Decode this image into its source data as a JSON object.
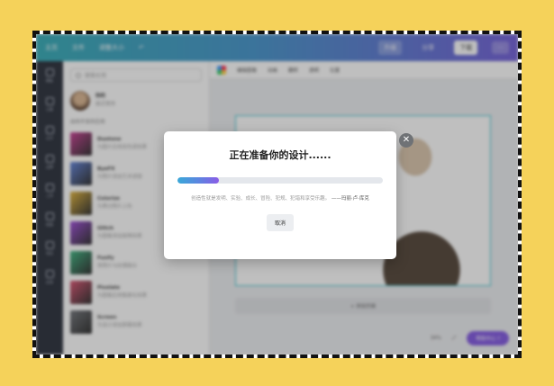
{
  "topbar": {
    "home": "主页",
    "file": "文件",
    "resize": "调整大小",
    "undo_icon": "undo-icon",
    "share": "分享",
    "download": "下载",
    "more": "···",
    "plan": "升级"
  },
  "sidebar_rail": [
    {
      "label": "模板",
      "icon": "template-icon"
    },
    {
      "label": "元素",
      "icon": "elements-icon"
    },
    {
      "label": "文字",
      "icon": "text-icon"
    },
    {
      "label": "品牌",
      "icon": "brand-icon"
    },
    {
      "label": "上传",
      "icon": "upload-icon"
    },
    {
      "label": "绘图",
      "icon": "draw-icon"
    },
    {
      "label": "项目",
      "icon": "project-icon"
    },
    {
      "label": "应用",
      "icon": "apps-icon"
    }
  ],
  "panel": {
    "search_placeholder": "搜索应用",
    "owner_name": "你的",
    "owner_desc": "最近使用",
    "section_title": "由你开发的应用",
    "items": [
      {
        "name": "Duotone",
        "desc": "为图片应用双色调效果",
        "color": "#c7358f"
      },
      {
        "name": "ByeFX",
        "desc": "为照片添加艺术滤镜",
        "color": "#5a7dd8"
      },
      {
        "name": "Colorize",
        "desc": "为黑白照片上色",
        "color": "#e0b030"
      },
      {
        "name": "Glitch",
        "desc": "为图像添加故障效果",
        "color": "#9a45d8"
      },
      {
        "name": "Fusify",
        "desc": "将照片与纹理融合",
        "color": "#35b07a"
      },
      {
        "name": "Pixelate",
        "desc": "为图像应用像素化效果",
        "color": "#d84a6a"
      },
      {
        "name": "Screen",
        "desc": "为设计添加屏幕效果",
        "color": "#6a6d73"
      }
    ]
  },
  "canvas": {
    "tools": [
      "编辑图像",
      "动画",
      "翻转",
      "透明",
      "位置"
    ],
    "add_page": "+ 添加页面",
    "zoom": "34%",
    "fab_label": "帮助中心 ?"
  },
  "dialog": {
    "title": "正在准备你的设计......",
    "progress": 0.2,
    "quote": "创造性就是发明、实验、成长、冒险、犯规、犯错和享受乐趣。",
    "author": "——玛丽·卢·库克",
    "cancel": "取消"
  },
  "colors": {
    "background": "#f5d25a",
    "progress_start": "#3aa8d8",
    "progress_end": "#8a5ce6"
  }
}
